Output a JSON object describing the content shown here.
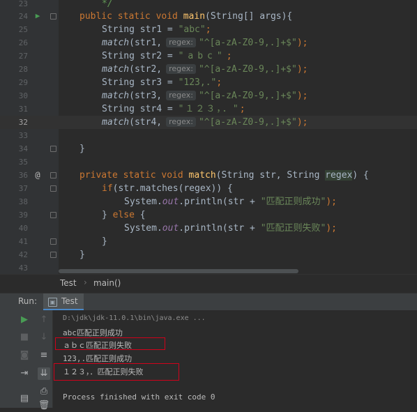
{
  "editor": {
    "lines": [
      {
        "num": "23"
      },
      {
        "num": "24"
      },
      {
        "num": "25"
      },
      {
        "num": "26"
      },
      {
        "num": "27"
      },
      {
        "num": "28"
      },
      {
        "num": "29"
      },
      {
        "num": "30"
      },
      {
        "num": "31"
      },
      {
        "num": "32"
      },
      {
        "num": "33"
      },
      {
        "num": "34"
      },
      {
        "num": "35"
      },
      {
        "num": "36"
      },
      {
        "num": "37"
      },
      {
        "num": "38"
      },
      {
        "num": "39"
      },
      {
        "num": "40"
      },
      {
        "num": "41"
      },
      {
        "num": "42"
      },
      {
        "num": "43"
      }
    ],
    "comment_end": "*/",
    "main_sig": {
      "kw": "public static void ",
      "name": "main",
      "params": "(String[] args){"
    },
    "decl1": {
      "type": "String str1 = ",
      "val": "\"abc\"",
      "end": ";"
    },
    "call1": {
      "fn": "match",
      "arg": "(str1,",
      "hint": "regex:",
      "val": "\"^[a-zA-Z0-9,.]+$\"",
      "end": ");"
    },
    "decl2": {
      "type": "String str2 = ",
      "val": "\"abc\"",
      "end": ";"
    },
    "call2": {
      "fn": "match",
      "arg": "(str2,",
      "hint": "regex:",
      "val": "\"^[a-zA-Z0-9,.]+$\"",
      "end": ");"
    },
    "decl3": {
      "type": "String str3 = ",
      "val": "\"123,.\"",
      "end": ";"
    },
    "call3": {
      "fn": "match",
      "arg": "(str3,",
      "hint": "regex:",
      "val": "\"^[a-zA-Z0-9,.]+$\"",
      "end": ");"
    },
    "decl4": {
      "type": "String str4 = ",
      "val": "\"１２３，．\"",
      "end": ";"
    },
    "call4": {
      "fn": "match",
      "arg": "(str4,",
      "hint": "regex:",
      "val": "\"^[a-zA-Z0-9,.]+$\"",
      "end": ");"
    },
    "close_main": "}",
    "match_sig": {
      "kw": "private static void ",
      "name": "match",
      "p1": "(String str, String ",
      "p2": "regex",
      "p3": ") {"
    },
    "if_line": {
      "kw": "if",
      "rest": "(str.matches(regex)) {"
    },
    "print1": {
      "pre": "System.",
      "out": "out",
      "mid": ".println(str + ",
      "val": "\"匹配正则成功\"",
      "end": ");"
    },
    "else_line": {
      "pre": "} ",
      "kw": "else",
      "post": " {"
    },
    "print2": {
      "pre": "System.",
      "out": "out",
      "mid": ".println(str + ",
      "val": "\"匹配正则失败\"",
      "end": ");"
    },
    "close_if": "}",
    "close_match": "}"
  },
  "breadcrumb": {
    "class_name": "Test",
    "sep": "›",
    "method": "main()"
  },
  "run_panel": {
    "label": "Run:",
    "tab": "Test"
  },
  "console": {
    "command": "D:\\jdk\\jdk-11.0.1\\bin\\java.exe ...",
    "lines": [
      "abc匹配正则成功",
      "ａｂｃ匹配正则失败",
      "123,.匹配正则成功",
      "１２３，．匹配正则失败"
    ],
    "exit": "Process finished with exit code 0"
  },
  "colors": {
    "keyword": "#cc7832",
    "string": "#6a8759",
    "function": "#ffc66d",
    "highlight_box": "#d0021b"
  },
  "icons": [
    "run-gutter-icon",
    "override-icon",
    "rerun-icon",
    "stop-icon",
    "scroll-up-icon",
    "scroll-down-icon",
    "camera-icon",
    "soft-wrap-icon",
    "exit-icon",
    "scroll-to-end-icon",
    "print-icon",
    "layout-icon",
    "trash-icon"
  ]
}
